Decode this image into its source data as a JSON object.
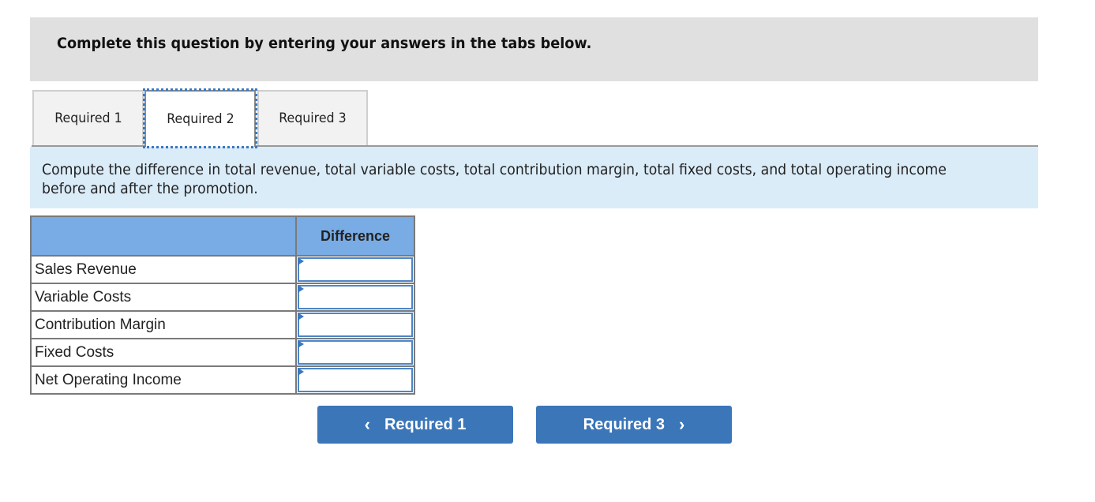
{
  "instruction": "Complete this question by entering your answers in the tabs below.",
  "tabs": [
    {
      "label": "Required 1",
      "active": false
    },
    {
      "label": "Required 2",
      "active": true
    },
    {
      "label": "Required 3",
      "active": false
    }
  ],
  "prompt": "Compute the difference in total revenue, total variable costs, total contribution margin, total fixed costs, and total operating income before and after the promotion.",
  "table": {
    "headers": [
      "",
      "Difference"
    ],
    "rows": [
      {
        "label": "Sales Revenue",
        "value": ""
      },
      {
        "label": "Variable Costs",
        "value": ""
      },
      {
        "label": "Contribution Margin",
        "value": ""
      },
      {
        "label": "Fixed Costs",
        "value": ""
      },
      {
        "label": "Net Operating Income",
        "value": ""
      }
    ]
  },
  "navigation": {
    "prev": {
      "label": "Required 1",
      "icon": "chevron-left-icon",
      "glyph": "‹"
    },
    "next": {
      "label": "Required 3",
      "icon": "chevron-right-icon",
      "glyph": "›"
    }
  },
  "colors": {
    "header_fill": "#79abe4",
    "button_fill": "#3b76b9",
    "prompt_fill": "#dbecf9",
    "instruction_fill": "#e0e0e0",
    "focus_outline": "#3a78c2"
  }
}
